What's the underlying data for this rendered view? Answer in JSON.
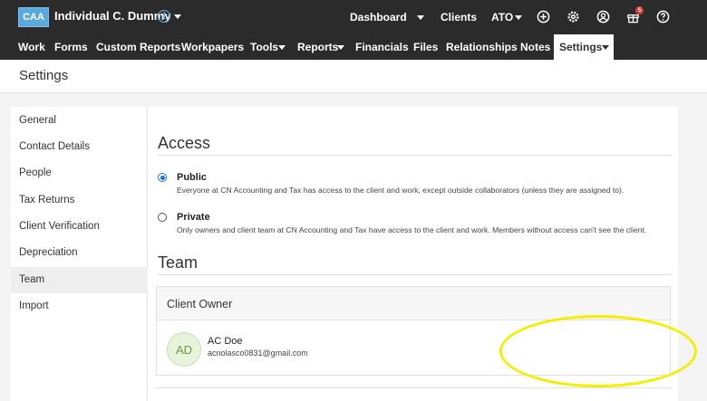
{
  "header": {
    "client_badge": "CAA",
    "client_name": "Individual C. Dummy",
    "info_glyph": "i",
    "menu_dashboard": "Dashboard",
    "menu_clients": "Clients",
    "menu_ato": "ATO",
    "gift_count": "5",
    "icons": [
      "plus-circle-icon",
      "gear-icon",
      "user-circle-icon",
      "gift-icon",
      "help-icon"
    ]
  },
  "nav": {
    "items": [
      {
        "label": "Work"
      },
      {
        "label": "Forms"
      },
      {
        "label": "Custom Reports"
      },
      {
        "label": "Workpapers"
      },
      {
        "label": "Tools"
      },
      {
        "label": "Reports"
      },
      {
        "label": "Financials"
      },
      {
        "label": "Files"
      },
      {
        "label": "Relationships"
      },
      {
        "label": "Notes"
      },
      {
        "label": "Settings"
      }
    ],
    "active": "Settings"
  },
  "page": {
    "title": "Settings"
  },
  "sidebar": {
    "items": [
      {
        "label": "General"
      },
      {
        "label": "Contact Details"
      },
      {
        "label": "People"
      },
      {
        "label": "Tax Returns"
      },
      {
        "label": "Client Verification"
      },
      {
        "label": "Depreciation"
      },
      {
        "label": "Team"
      },
      {
        "label": "Import"
      }
    ],
    "active": "Team"
  },
  "access": {
    "title": "Access",
    "selected": "Public",
    "options": [
      {
        "label": "Public",
        "description": "Everyone at CN Accounting and Tax has access to the client and work, except outside collaborators (unless they are assigned to)."
      },
      {
        "label": "Private",
        "description": "Only owners and client team at CN Accounting and Tax have access to the client and work. Members without access can't see the client."
      }
    ]
  },
  "team": {
    "title": "Team",
    "owner_heading": "Client Owner",
    "owner": {
      "initials": "AD",
      "name": "AC Doe",
      "email": "acnolasco0831@gmail.com"
    }
  },
  "colors": {
    "topbar": "#2b2b2b",
    "badge": "#5aa9dd",
    "accent": "#1a73d9",
    "highlight": "#f5ee00",
    "notification": "#e53935"
  }
}
